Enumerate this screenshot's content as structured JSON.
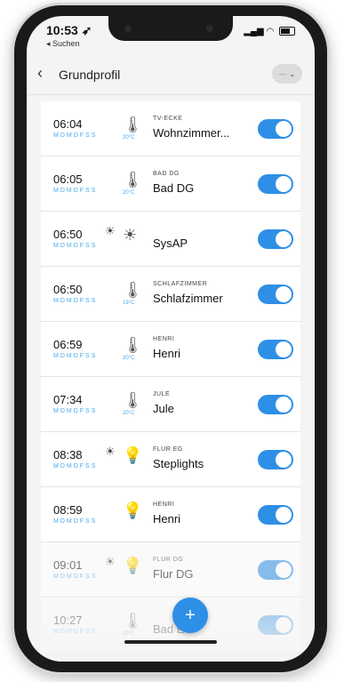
{
  "status": {
    "time": "10:53 ➶",
    "back_app": "◂ Suchen"
  },
  "header": {
    "title": "Grundprofil",
    "menu_label": "··· ⌄"
  },
  "icons": {
    "back": "chevron-left",
    "sun": "sun",
    "thermostat": "thermometer",
    "light": "lightbulb"
  },
  "rows": [
    {
      "time": "06:04",
      "days": "MDMDFSS",
      "astro": "",
      "device_icon": "🌡",
      "temp": "20°C",
      "room": "TV-ECKE",
      "name": "Wohnzimmer...",
      "dim": false
    },
    {
      "time": "06:05",
      "days": "MDMDFSS",
      "astro": "",
      "device_icon": "🌡",
      "temp": "20°C",
      "room": "BAD DG",
      "name": "Bad DG",
      "dim": false
    },
    {
      "time": "06:50",
      "days": "MDMDFSS",
      "astro": "☀",
      "device_icon": "☀",
      "temp": "",
      "room": "",
      "name": "SysAP",
      "dim": false
    },
    {
      "time": "06:50",
      "days": "MDMDFSS",
      "astro": "",
      "device_icon": "🌡",
      "temp": "19°C",
      "room": "SCHLAFZIMMER",
      "name": "Schlafzimmer",
      "dim": false
    },
    {
      "time": "06:59",
      "days": "MDMDFSS",
      "astro": "",
      "device_icon": "🌡",
      "temp": "20°C",
      "room": "HENRI",
      "name": "Henri",
      "dim": false
    },
    {
      "time": "07:34",
      "days": "MDMDFSS",
      "astro": "",
      "device_icon": "🌡",
      "temp": "20°C",
      "room": "JULE",
      "name": "Jule",
      "dim": false
    },
    {
      "time": "08:38",
      "days": "MDMDFSS",
      "astro": "☀",
      "device_icon": "💡",
      "temp": "",
      "room": "FLUR EG",
      "name": "Steplights",
      "dim": false
    },
    {
      "time": "08:59",
      "days": "MDMDFSS",
      "astro": "",
      "device_icon": "💡",
      "temp": "",
      "room": "HENRI",
      "name": "Henri",
      "dim": false
    },
    {
      "time": "09:01",
      "days": "MDMDFSS",
      "astro": "☀",
      "device_icon": "💡",
      "temp": "",
      "room": "FLUR DG",
      "name": "Flur DG",
      "dim": true
    },
    {
      "time": "10:27",
      "days": "MDMDFSS",
      "astro": "",
      "device_icon": "🌡",
      "temp": "20°C",
      "room": "",
      "name": "Bad EG",
      "dim": true
    }
  ],
  "fab_label": "+"
}
